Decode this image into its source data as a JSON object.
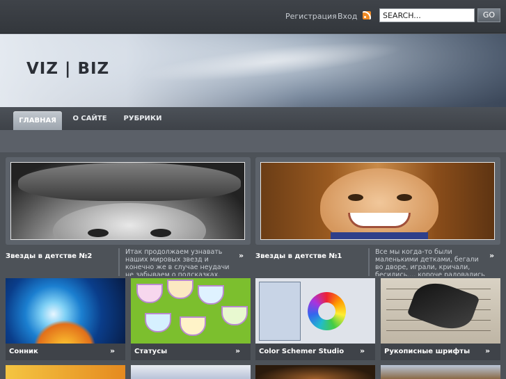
{
  "topbar": {
    "register": "Регистрация",
    "login": "Вход",
    "search_placeholder": "SEARCH...",
    "go": "GO"
  },
  "header": {
    "logo": "VIZ | BIZ"
  },
  "nav": {
    "items": [
      "ГЛАВНАЯ",
      "О САЙТЕ",
      "РУБРИКИ"
    ],
    "active": "ГЛАВНАЯ"
  },
  "features": [
    {
      "title": "Звезды  в детстве №2",
      "desc": "Итак продолжаем узнавать наших мировых звезд и конечно же в случае неудачи не забываем о подсказках."
    },
    {
      "title": "Звезды  в детстве №1",
      "desc": "Все мы когда-то были маленькими детками, бегали во дворе, играли, кричали, бесились.... короче радовались жизни. Наверно все"
    }
  ],
  "tiles": [
    {
      "label": "Сонник"
    },
    {
      "label": "Статусы"
    },
    {
      "label": "Color Schemer Studio"
    },
    {
      "label": "Рукописные шрифты"
    }
  ],
  "arrow": "»",
  "colors": {
    "background": "#50555c",
    "topbar": "#3f4349",
    "nav": "#4c5158",
    "active_tab": "#aeb5bd",
    "rss": "#f08a24"
  }
}
